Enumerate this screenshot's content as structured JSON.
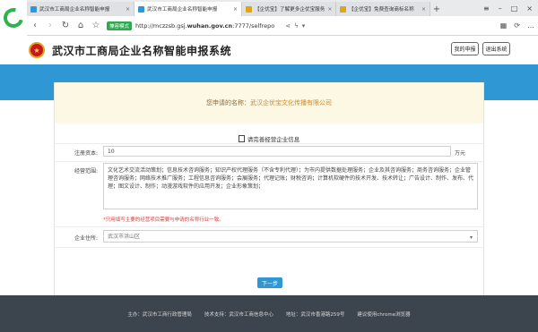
{
  "browser": {
    "tabs": [
      {
        "label": "武汉市工商局企业名称智能申报",
        "active": false
      },
      {
        "label": "武汉市工商局企业名称智能申报",
        "active": true
      },
      {
        "label": "【企优宝】了解更多企优宝服务",
        "active": false
      },
      {
        "label": "【企优宝】免费查询商标名称",
        "active": false
      }
    ],
    "new_tab": "+",
    "url_badge": "兼容模式",
    "url_prefix": "http://mczzsb.gsj.",
    "url_domain": "wuhan.gov.cn",
    "url_suffix": ":7777/selfrepo"
  },
  "header": {
    "title": "武汉市工商局企业名称智能申报系统",
    "my_apply_button": "我的申报",
    "logout_button": "退出系统"
  },
  "notice": {
    "prefix": "您申请的名称：",
    "company_name": "武汉企优宝文化传播有限公司"
  },
  "form": {
    "heading": "请完善经营企业信息",
    "capital_label": "注册资本:",
    "capital_value": "10",
    "capital_unit": "万元",
    "scope_label": "经营范围:",
    "scope_value": "文化艺术交流活动策划；信息技术咨询服务；知识产权代理服务（不含专利代理）；为市内提供数据处理服务；企业及其咨询服务；商务咨询服务；企业管理咨询服务；网络技术推广服务；工程信息咨询服务；会展服务；代理记账；财税咨询；计算机软硬件的技术开发、技术转让；广告设计、制作、发布、代理；图文设计、制作；动漫游戏软件的应用开发；企业形象策划；",
    "scope_hint": "*只用填写主要的经营项目需要与申请的名称行业一致。",
    "region_label": "企业住所:",
    "region_value": "武汉市洪山区",
    "next_button": "下一步"
  },
  "footer": {
    "host": "主办：武汉市工商行政管理局",
    "support": "技术支持：武汉市工商信息中心",
    "address": "地址：武汉市香港路259号",
    "browser_tip": "建议使用chrome浏览器"
  }
}
